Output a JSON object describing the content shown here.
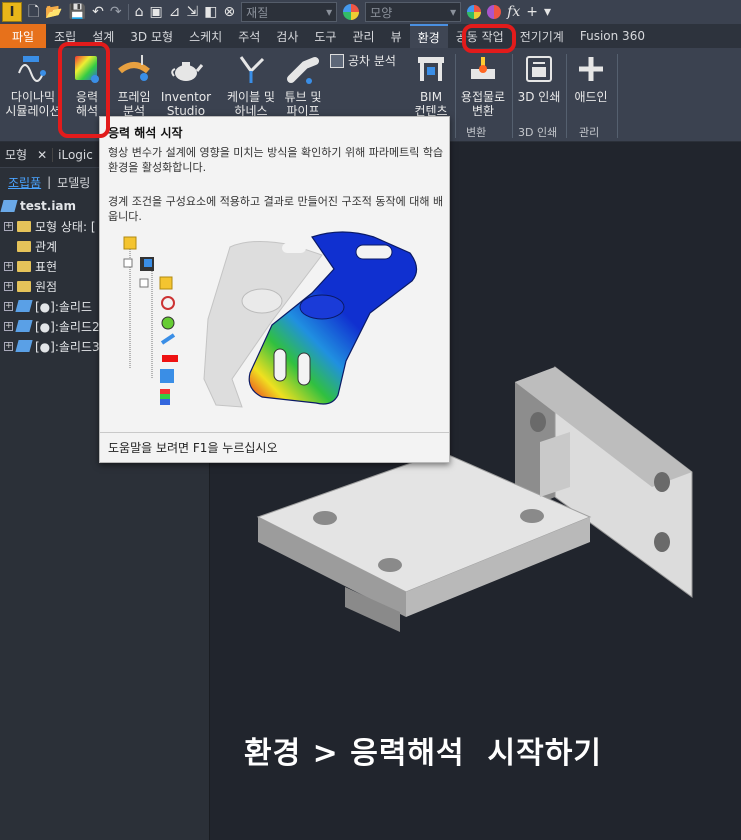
{
  "qat": {
    "logo_letter": "I",
    "material_placeholder": "재질",
    "appearance_placeholder": "모양",
    "fx_label": "fx"
  },
  "tabs": [
    "파일",
    "조립",
    "설계",
    "3D 모형",
    "스케치",
    "주석",
    "검사",
    "도구",
    "관리",
    "뷰",
    "환경",
    "공동 작업",
    "전기기계",
    "Fusion 360"
  ],
  "active_tab": "환경",
  "ribbon": {
    "dynamic_sim": "다이나믹\n시뮬레이션",
    "stress_analysis": "응력\n해석",
    "frame_analysis": "프레임\n분석",
    "inventor_studio": "Inventor\nStudio",
    "cable_harness": "케이블 및\n하네스",
    "tube_pipe": "튜브 및\n파이프",
    "tolerance_analysis": "공차 분석",
    "bim_content": "BIM\n컨텐츠",
    "weldment_convert": "용접물로\n변환",
    "print_3d": "3D 인쇄",
    "addin": "애드인",
    "group_convert": "변환",
    "group_3dprint": "3D 인쇄",
    "group_manage": "관리"
  },
  "panel": {
    "tab_model": "모형",
    "tab_close": "✕",
    "tab_ilogic": "iLogic",
    "view_assembly": "조립품",
    "view_modeling": "모델링",
    "tree": [
      {
        "label": "test.iam",
        "kind": "root"
      },
      {
        "label": "모형 상태: [",
        "kind": "folder-exp"
      },
      {
        "label": "관계",
        "kind": "folder"
      },
      {
        "label": "표현",
        "kind": "folder-exp"
      },
      {
        "label": "원점",
        "kind": "folder-exp"
      },
      {
        "label": "[●]:솔리드",
        "kind": "part"
      },
      {
        "label": "[●]:솔리드2",
        "kind": "part"
      },
      {
        "label": "[●]:솔리드3",
        "kind": "part"
      }
    ]
  },
  "tooltip": {
    "title": "응력 해석 시작",
    "desc1": "형상 변수가 설계에 영향을 미치는 방식을 확인하기 위해 파라메트릭 학습 환경을 활성화합니다.",
    "desc2": "경계 조건을 구성요소에 적용하고 결과로 만들어진 구조적 동작에 대해 배웁니다.",
    "footer": "도움말을 보려면 F1을 누르십시오"
  },
  "caption": "환경 > 응력해석  시작하기",
  "colors": {
    "highlight": "#e21b1b",
    "file_tab": "#e7711b",
    "link": "#4aa3ff"
  }
}
